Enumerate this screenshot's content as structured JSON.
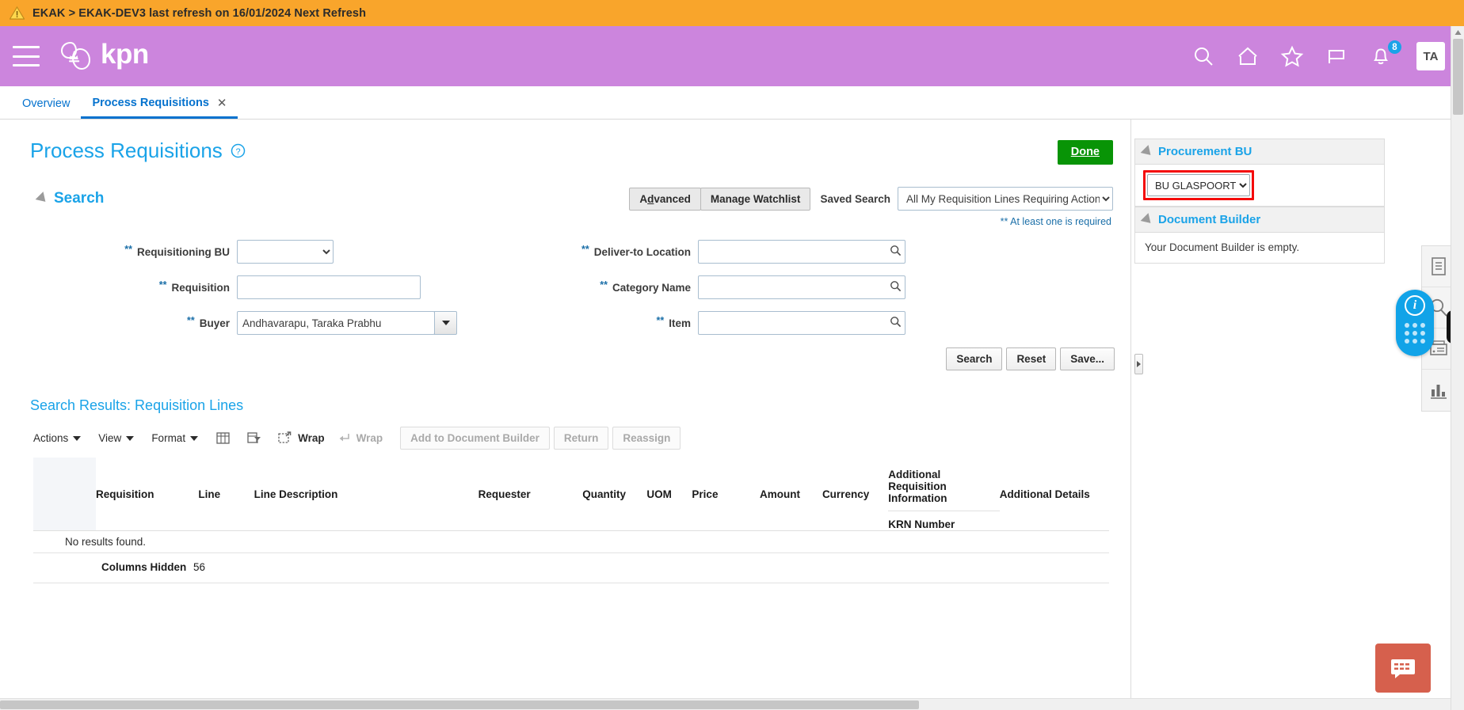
{
  "alert": {
    "icon": "warning-triangle-icon",
    "text": "EKAK > EKAK-DEV3 last refresh on 16/01/2024 Next Refresh"
  },
  "header": {
    "brand": "kpn",
    "menu_icon": "hamburger-menu-icon",
    "icons": [
      {
        "name": "search-icon"
      },
      {
        "name": "home-icon"
      },
      {
        "name": "favorites-star-icon"
      },
      {
        "name": "flag-icon"
      },
      {
        "name": "notifications-bell-icon",
        "badge": "8"
      }
    ],
    "avatar": "TA",
    "brand_color": "#cc85dd",
    "badge_color": "#1aa3e8"
  },
  "tabs": [
    {
      "label": "Overview",
      "active": false,
      "closable": false
    },
    {
      "label": "Process Requisitions",
      "active": true,
      "closable": true,
      "close_icon": "close-icon"
    }
  ],
  "page": {
    "title": "Process Requisitions",
    "help_icon": "help-circle-icon",
    "done_label": "Done"
  },
  "search": {
    "section_label": "Search",
    "advanced_label": "Advanced",
    "manage_watchlist_label": "Manage Watchlist",
    "saved_search_label": "Saved Search",
    "saved_search_value": "All My Requisition Lines Requiring Action",
    "saved_search_options": [
      "All My Requisition Lines Requiring Action"
    ],
    "required_note": "** At least one is required",
    "required_marker": "**",
    "fields": {
      "requisitioning_bu": {
        "label": "Requisitioning BU",
        "value": "",
        "type": "select",
        "options": [
          ""
        ]
      },
      "requisition": {
        "label": "Requisition",
        "value": "",
        "placeholder": "",
        "type": "text"
      },
      "buyer": {
        "label": "Buyer",
        "value": "Andhavarapu, Taraka Prabhu",
        "type": "lov"
      },
      "deliver_to_location": {
        "label": "Deliver-to Location",
        "value": "",
        "placeholder": "",
        "type": "search",
        "icon": "search-icon"
      },
      "category_name": {
        "label": "Category Name",
        "value": "",
        "placeholder": "",
        "type": "search",
        "icon": "search-icon"
      },
      "item": {
        "label": "Item",
        "value": "",
        "placeholder": "",
        "type": "search",
        "icon": "search-icon"
      }
    },
    "buttons": [
      {
        "label": "Search",
        "disabled": false
      },
      {
        "label": "Reset",
        "disabled": false
      },
      {
        "label": "Save...",
        "disabled": false
      }
    ]
  },
  "results": {
    "title": "Search Results: Requisition Lines",
    "toolbar": {
      "menus": [
        {
          "label": "Actions",
          "icon": "chevron-down-icon"
        },
        {
          "label": "View",
          "icon": "chevron-down-icon"
        },
        {
          "label": "Format",
          "icon": "chevron-down-icon"
        }
      ],
      "icons": [
        {
          "name": "freeze-columns-icon"
        },
        {
          "name": "detach-filter-icon"
        },
        {
          "name": "detach-icon",
          "label": "Detach"
        },
        {
          "name": "wrap-icon",
          "label": "Wrap",
          "disabled": true
        }
      ],
      "buttons": [
        {
          "label": "Add to Document Builder",
          "disabled": true
        },
        {
          "label": "Return",
          "disabled": true
        },
        {
          "label": "Reassign",
          "disabled": true
        }
      ]
    },
    "columns": [
      "Requisition",
      "Line",
      "Line Description",
      "Requester",
      "Quantity",
      "UOM",
      "Price",
      "Amount",
      "Currency"
    ],
    "column_group": {
      "label": "Additional Requisition Information",
      "sub": "KRN Number"
    },
    "last_column": "Additional Details",
    "rows": [],
    "no_results_text": "No results found.",
    "columns_hidden_label": "Columns Hidden",
    "columns_hidden_count": "56"
  },
  "side_panel": {
    "procurement_bu": {
      "title": "Procurement BU",
      "value": "BU GLASPOORT",
      "options": [
        "BU GLASPOORT"
      ],
      "highlight_color": "#f40b0b"
    },
    "document_builder": {
      "title": "Document Builder",
      "empty_text": "Your Document Builder is empty."
    }
  },
  "rail": {
    "items": [
      {
        "name": "document-icon"
      },
      {
        "name": "magnifier-icon"
      },
      {
        "name": "list-card-icon"
      },
      {
        "name": "bar-chart-icon"
      }
    ],
    "fab": {
      "name": "info-drag-widget",
      "glyph": "i"
    }
  },
  "chat": {
    "name": "chat-bubble-button",
    "icon": "chat-icon"
  }
}
